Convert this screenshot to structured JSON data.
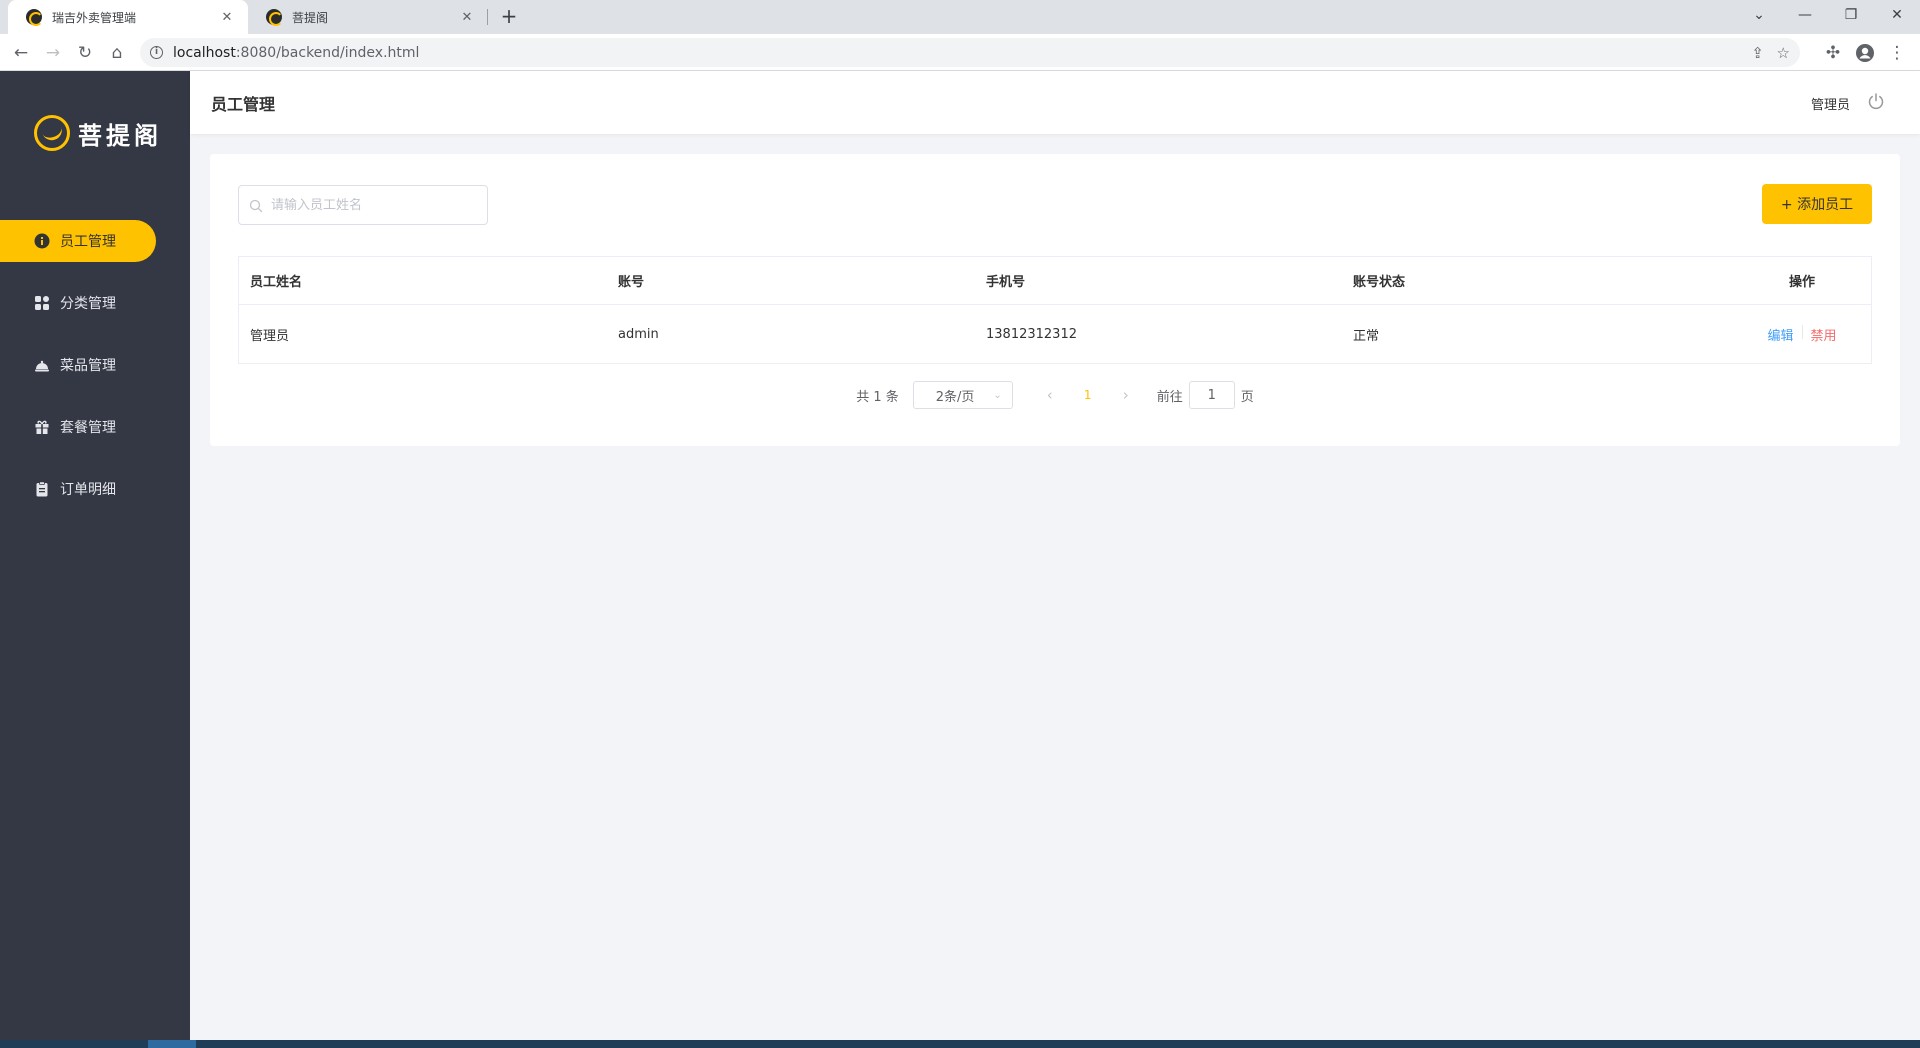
{
  "browser": {
    "tabs": [
      {
        "title": "瑞吉外卖管理端",
        "active": true
      },
      {
        "title": "菩提阁",
        "active": false
      }
    ],
    "url_host": "localhost",
    "url_path": ":8080/backend/index.html"
  },
  "sidebar": {
    "logo_text": "菩提阁",
    "items": [
      {
        "label": "员工管理",
        "icon": "employee-icon",
        "active": true
      },
      {
        "label": "分类管理",
        "icon": "category-icon",
        "active": false
      },
      {
        "label": "菜品管理",
        "icon": "dish-icon",
        "active": false
      },
      {
        "label": "套餐管理",
        "icon": "combo-gift-icon",
        "active": false
      },
      {
        "label": "订单明细",
        "icon": "order-clipboard-icon",
        "active": false
      }
    ]
  },
  "header": {
    "title": "员工管理",
    "user": "管理员"
  },
  "toolbar": {
    "search_placeholder": "请输入员工姓名",
    "add_label": "+ 添加员工"
  },
  "table": {
    "columns": [
      "员工姓名",
      "账号",
      "手机号",
      "账号状态",
      "操作"
    ],
    "rows": [
      {
        "name": "管理员",
        "account": "admin",
        "phone": "13812312312",
        "status": "正常",
        "edit": "编辑",
        "disable": "禁用"
      }
    ]
  },
  "pagination": {
    "total": "共 1 条",
    "page_size": "2条/页",
    "current_page": "1",
    "goto_prefix": "前往",
    "goto_value": "1",
    "goto_suffix": "页"
  },
  "colors": {
    "accent": "#ffc200",
    "sidebar_bg": "#343744",
    "link_edit": "#419efa",
    "link_disable": "#f56c6c"
  }
}
